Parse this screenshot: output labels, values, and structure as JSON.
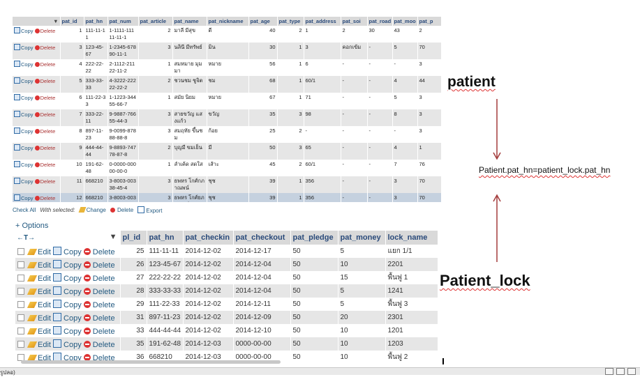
{
  "annotations": {
    "patient_label": "patient",
    "patient_lock_label": "Patient_lock",
    "join_condition": "Patient.pat_hn=patient_lock.pat_hn",
    "arrow_color": "#a33a3a"
  },
  "patient_table": {
    "columns": [
      "pat_id",
      "pat_hn",
      "pat_num",
      "pat_article",
      "pat_name",
      "pat_nickname",
      "pat_age",
      "pat_type",
      "pat_address",
      "pat_soi",
      "pat_road",
      "pat_moo",
      "pat_p"
    ],
    "row_actions": {
      "copy": "Copy",
      "delete": "Delete"
    },
    "rows": [
      [
        "1",
        "111-11-11",
        "1-1111-11111-11-1",
        "2",
        "มาลี มีสุข",
        "ดี",
        "40",
        "2",
        "1",
        "2",
        "30",
        "43",
        "2"
      ],
      [
        "3",
        "123-45-67",
        "1-2345-67890-11-1",
        "3",
        "นลินี มีทรัพย์",
        "มิน",
        "30",
        "1",
        "3",
        "คอกเข้ม",
        "-",
        "5",
        "70"
      ],
      [
        "4",
        "222-22-22",
        "2-1112-21122-11-2",
        "1",
        "สมหมาย มุมมา",
        "หมาย",
        "56",
        "1",
        "6",
        "-",
        "-",
        "-",
        "3"
      ],
      [
        "5",
        "333-33-33",
        "4-3222-22222-22-2",
        "2",
        "ชวนชม ชูจิต",
        "ชม",
        "68",
        "1",
        "60/1",
        "-",
        "-",
        "4",
        "44"
      ],
      [
        "6",
        "111-22-33",
        "1-1223-34455-66-7",
        "1",
        "สมัย นิยม",
        "หมาย",
        "67",
        "1",
        "71",
        "-",
        "-",
        "5",
        "3"
      ],
      [
        "7",
        "333-22-11",
        "9-9887-76655-44-3",
        "3",
        "สายขวัญ แสงแก้ว",
        "ขวัญ",
        "35",
        "3",
        "98",
        "-",
        "-",
        "8",
        "3"
      ],
      [
        "8",
        "897-11-23",
        "9-0099-87888-88-8",
        "3",
        "สมฤทัย ขึ้นชม",
        "ก้อย",
        "25",
        "2",
        "-",
        "-",
        "-",
        "-",
        "3"
      ],
      [
        "9",
        "444-44-44",
        "9-8893-74778-87-8",
        "2",
        "บุญมี ขมเย็น",
        "มี",
        "50",
        "3",
        "65",
        "-",
        "-",
        "4",
        "1"
      ],
      [
        "10",
        "191-62-48",
        "0-0000-00000-00-0",
        "1",
        "ลำเค้ด สดใส",
        "เส้าะ",
        "45",
        "2",
        "60/1",
        "-",
        "-",
        "7",
        "76"
      ],
      [
        "11",
        "668210",
        "3-8003-00338-45-4",
        "3",
        "ธพหร โกศ์กภาณพน์",
        "ชุช",
        "39",
        "1",
        "356",
        "-",
        "-",
        "3",
        "70"
      ],
      [
        "12",
        "668210",
        "3-8003-00338-45-4",
        "3",
        "ธพหร โกศ์ยภาณพน์",
        "ชุช",
        "39",
        "1",
        "356",
        "-",
        "-",
        "3",
        "70"
      ]
    ],
    "footer": {
      "check_all": "Check All",
      "with_selected": "With selected:",
      "change": "Change",
      "delete": "Delete",
      "export": "Export"
    }
  },
  "options_link": "+ Options",
  "sort_control": "←T→",
  "patient_lock_table": {
    "columns": [
      "pl_id",
      "pat_hn",
      "pat_checkin",
      "pat_checkout",
      "pat_pledge",
      "pat_money",
      "lock_name"
    ],
    "row_actions": {
      "edit": "Edit",
      "copy": "Copy",
      "delete": "Delete"
    },
    "rows": [
      [
        "25",
        "111-11-11",
        "2014-12-02",
        "2014-12-17",
        "50",
        "5",
        "แยก 1/1"
      ],
      [
        "26",
        "123-45-67",
        "2014-12-02",
        "2014-12-04",
        "50",
        "10",
        "2201"
      ],
      [
        "27",
        "222-22-22",
        "2014-12-02",
        "2014-12-04",
        "50",
        "15",
        "พื้นฟู 1"
      ],
      [
        "28",
        "333-33-33",
        "2014-12-02",
        "2014-12-04",
        "50",
        "5",
        "1241"
      ],
      [
        "29",
        "111-22-33",
        "2014-12-02",
        "2014-12-11",
        "50",
        "5",
        "พื้นฟู 3"
      ],
      [
        "31",
        "897-11-23",
        "2014-12-02",
        "2014-12-09",
        "50",
        "20",
        "2301"
      ],
      [
        "33",
        "444-44-44",
        "2014-12-02",
        "2014-12-10",
        "50",
        "10",
        "1201"
      ],
      [
        "35",
        "191-62-48",
        "2014-12-03",
        "0000-00-00",
        "50",
        "10",
        "1203"
      ],
      [
        "36",
        "668210",
        "2014-12-03",
        "0000-00-00",
        "50",
        "10",
        "พื้นฟู 2"
      ]
    ]
  },
  "statusbar": {
    "left_text": "รูปลอ)"
  }
}
